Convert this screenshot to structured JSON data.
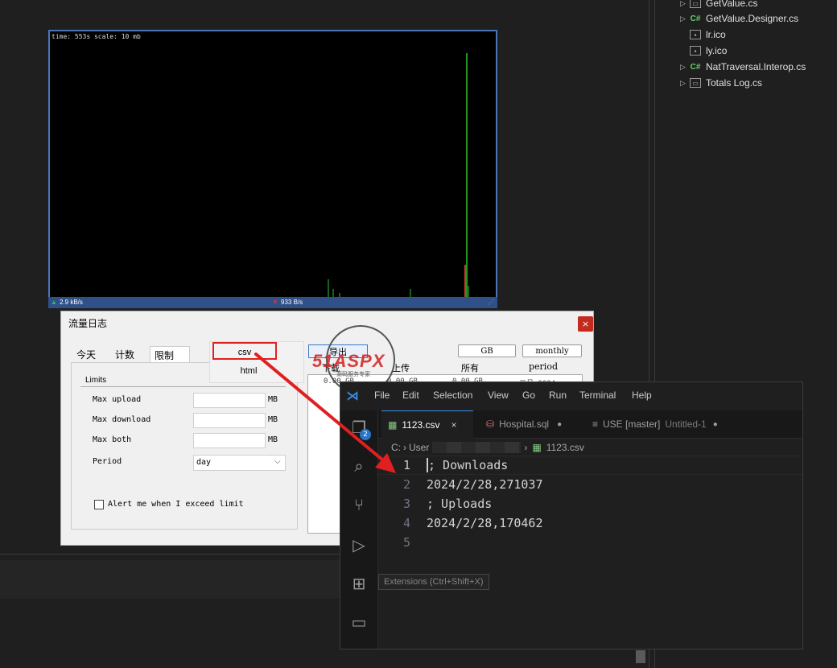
{
  "solution_explorer": {
    "items": [
      {
        "label": "GetValue.cs",
        "icon": "form-icon",
        "has_arrow": true
      },
      {
        "label": "GetValue.Designer.cs",
        "icon": "csharp-icon",
        "has_arrow": true
      },
      {
        "label": "lr.ico",
        "icon": "icon-file-icon",
        "has_arrow": false
      },
      {
        "label": "ly.ico",
        "icon": "icon-file-icon",
        "has_arrow": false
      },
      {
        "label": "NatTraversal.Interop.cs",
        "icon": "csharp-icon",
        "has_arrow": true
      },
      {
        "label": "Totals Log.cs",
        "icon": "form-icon",
        "has_arrow": true
      }
    ]
  },
  "graph": {
    "info": "time: 553s scale: 10 mb",
    "upload_speed": "2.9 kB/s",
    "download_speed": "933 B/s"
  },
  "dialog": {
    "title": "流量日志",
    "close_glyph": "×",
    "tabs": [
      "今天",
      "计数",
      "限制"
    ],
    "limits_group": "Limits",
    "rows": [
      {
        "label": "Max upload",
        "value": "",
        "unit": "MB"
      },
      {
        "label": "Max download",
        "value": "",
        "unit": "MB"
      },
      {
        "label": "Max both",
        "value": "",
        "unit": "MB"
      }
    ],
    "period_label": "Period",
    "period_value": "day",
    "alert_label": "Alert me when I exceed limit",
    "export_button": "导出",
    "export_menu": [
      "csv",
      "html"
    ],
    "unit_select": "GB",
    "period_select": "monthly",
    "table_headers": [
      "下载",
      "上传",
      "所有",
      "period"
    ],
    "table_first_row": [
      "0.00 GB",
      "0.00 GB",
      "0.00 GB",
      "二月 2024"
    ]
  },
  "watermark": {
    "brand": "51ASPX",
    "tagline": "源码服务专家"
  },
  "vscode": {
    "menu": [
      "File",
      "Edit",
      "Selection",
      "View",
      "Go",
      "Run",
      "Terminal",
      "Help"
    ],
    "badge": "2",
    "tabs": [
      {
        "label": "1123.csv",
        "suffix": "",
        "marker": "×"
      },
      {
        "label": "Hospital.sql",
        "suffix": "",
        "marker": "●"
      },
      {
        "label": "USE [master]",
        "suffix": "Untitled-1",
        "marker": "●"
      }
    ],
    "breadcrumb": {
      "drive": "C:",
      "user": "User",
      "file": "1123.csv"
    },
    "lines": [
      {
        "n": "1",
        "text": "; Downloads"
      },
      {
        "n": "2",
        "text": "2024/2/28,271037"
      },
      {
        "n": "3",
        "text": "; Uploads"
      },
      {
        "n": "4",
        "text": "2024/2/28,170462"
      },
      {
        "n": "5",
        "text": ""
      }
    ],
    "tooltip": "Extensions (Ctrl+Shift+X)"
  }
}
